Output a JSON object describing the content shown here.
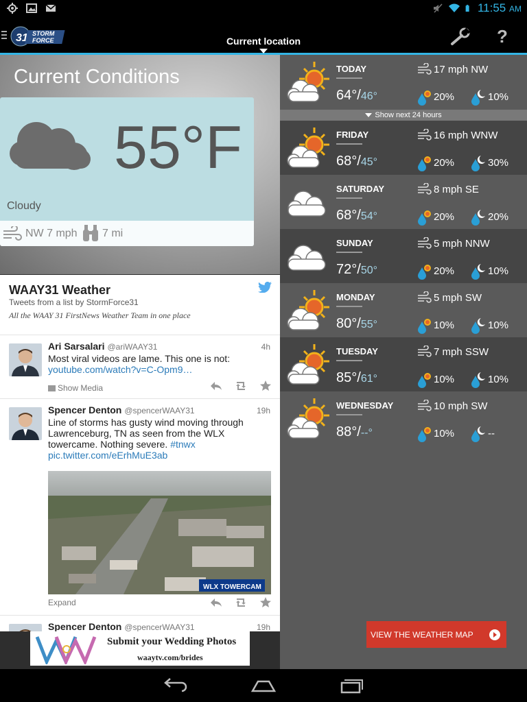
{
  "status_bar": {
    "time": "11:55",
    "ampm": "AM"
  },
  "app_bar": {
    "title": "Current location"
  },
  "current": {
    "heading": "Current Conditions",
    "temperature": "55°F",
    "condition": "Cloudy",
    "wind": "NW 7 mph",
    "visibility": "7 mi"
  },
  "twitter": {
    "title": "WAAY31 Weather",
    "subtitle": "Tweets from a list by StormForce31",
    "description": "All the WAAY 31 FirstNews Weather Team in one place",
    "tweets": [
      {
        "name": "Ari Sarsalari",
        "handle": "@ariWAAY31",
        "time": "4h",
        "text": "Most viral videos are lame.  This one is not:",
        "link": "youtube.com/watch?v=C-Opm9…",
        "media_label": "Show Media"
      },
      {
        "name": "Spencer Denton",
        "handle": "@spencerWAAY31",
        "time": "19h",
        "text": "Line of storms has gusty wind moving through Lawrenceburg, TN as seen from the WLX towercame. Nothing severe.",
        "hashtag": "#tnwx",
        "link": "pic.twitter.com/eErhMuE3ab",
        "expand_label": "Expand",
        "photo_caption": "WLX TOWERCAM"
      },
      {
        "name": "Spencer Denton",
        "handle": "@spencerWAAY31",
        "time": "19h"
      }
    ]
  },
  "ad": {
    "title": "Submit your Wedding Photos",
    "url": "waaytv.com/brides"
  },
  "forecast": {
    "next_24_label": "Show next 24 hours",
    "days": [
      {
        "name": "TODAY",
        "hi": "64°",
        "lo": "46°",
        "wind": "17 mph NW",
        "pop_day": "20%",
        "pop_night": "10%",
        "icon": "sun-cloud"
      },
      {
        "name": "FRIDAY",
        "hi": "68°",
        "lo": "45°",
        "wind": "16 mph WNW",
        "pop_day": "20%",
        "pop_night": "30%",
        "icon": "sun-cloud"
      },
      {
        "name": "SATURDAY",
        "hi": "68°",
        "lo": "54°",
        "wind": "8 mph SE",
        "pop_day": "20%",
        "pop_night": "20%",
        "icon": "cloud"
      },
      {
        "name": "SUNDAY",
        "hi": "72°",
        "lo": "50°",
        "wind": "5 mph NNW",
        "pop_day": "20%",
        "pop_night": "10%",
        "icon": "cloud"
      },
      {
        "name": "MONDAY",
        "hi": "80°",
        "lo": "55°",
        "wind": "5 mph SW",
        "pop_day": "10%",
        "pop_night": "10%",
        "icon": "sun-cloud"
      },
      {
        "name": "TUESDAY",
        "hi": "85°",
        "lo": "61°",
        "wind": "7 mph SSW",
        "pop_day": "10%",
        "pop_night": "10%",
        "icon": "sun-cloud"
      },
      {
        "name": "WEDNESDAY",
        "hi": "88°",
        "lo": "--°",
        "wind": "10 mph SW",
        "pop_day": "10%",
        "pop_night": "--",
        "icon": "sun-cloud"
      }
    ],
    "map_button": "VIEW THE WEATHER MAP"
  },
  "colors": {
    "accent": "#33b5e5",
    "map_button": "#d1392b",
    "low_temp": "#a8d6e8"
  }
}
